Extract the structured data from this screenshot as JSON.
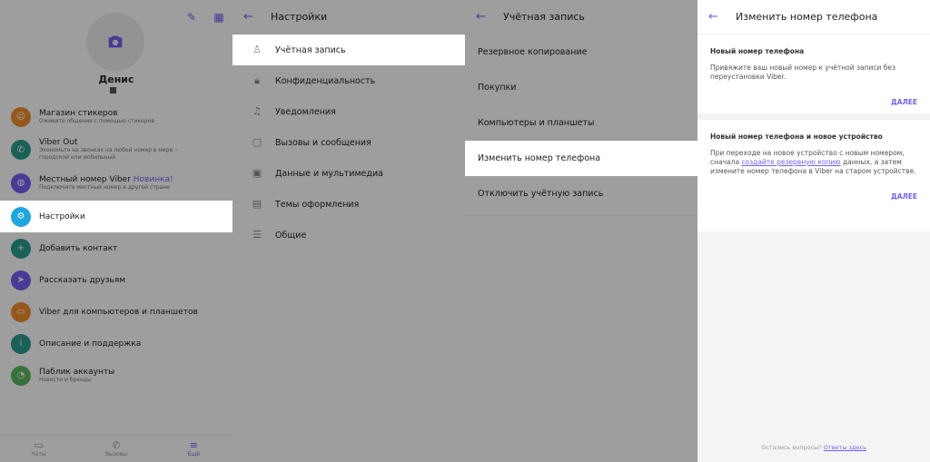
{
  "colors": {
    "accent": "#7360f2"
  },
  "panel1": {
    "user_name": "Денис",
    "menu": [
      {
        "title": "Магазин стикеров",
        "subtitle": "Оживите общение с помощью стикеров",
        "icon": "sticker-icon",
        "color": "#f28e2b"
      },
      {
        "title": "Viber Out",
        "subtitle": "Экономьте на звонках на любой номер в мире – городской или мобильный",
        "icon": "phone-icon",
        "color": "#2a9d8f"
      },
      {
        "title": "Местный номер Viber",
        "badge": "Новинка!",
        "subtitle": "Подключите местный номер в другой стране",
        "icon": "globe-icon",
        "color": "#7360f2"
      },
      {
        "title": "Настройки",
        "subtitle": "",
        "icon": "gear-icon",
        "color": "#1fa6e0"
      },
      {
        "title": "Добавить контакт",
        "subtitle": "",
        "icon": "add-contact-icon",
        "color": "#2a9d8f"
      },
      {
        "title": "Рассказать друзьям",
        "subtitle": "",
        "icon": "share-icon",
        "color": "#7360f2"
      },
      {
        "title": "Viber для компьютеров и планшетов",
        "subtitle": "",
        "icon": "desktop-icon",
        "color": "#f28e2b"
      },
      {
        "title": "Описание и поддержка",
        "subtitle": "",
        "icon": "info-icon",
        "color": "#2a9d8f"
      },
      {
        "title": "Паблик аккаунты",
        "subtitle": "Новости и бренды",
        "icon": "compass-icon",
        "color": "#5cb85c"
      }
    ],
    "bottom_nav": [
      {
        "label": "Чаты",
        "icon": "chat-icon"
      },
      {
        "label": "Вызовы",
        "icon": "phone-icon"
      },
      {
        "label": "Ещё",
        "icon": "menu-icon"
      }
    ]
  },
  "panel2": {
    "title": "Настройки",
    "items": [
      {
        "label": "Учётная запись",
        "icon": "user-icon"
      },
      {
        "label": "Конфиденциальность",
        "icon": "lock-icon"
      },
      {
        "label": "Уведомления",
        "icon": "bell-icon"
      },
      {
        "label": "Вызовы и сообщения",
        "icon": "message-icon"
      },
      {
        "label": "Данные и мультимедиа",
        "icon": "image-icon"
      },
      {
        "label": "Темы оформления",
        "icon": "brush-icon"
      },
      {
        "label": "Общие",
        "icon": "list-icon"
      }
    ]
  },
  "panel3": {
    "title": "Учётная запись",
    "items": [
      {
        "label": "Резервное копирование"
      },
      {
        "label": "Покупки"
      },
      {
        "label": "Компьютеры и планшеты"
      },
      {
        "label": "Изменить номер телефона"
      },
      {
        "label": "Отключить учётную запись"
      }
    ]
  },
  "panel4": {
    "title": "Изменить номер телефона",
    "card1": {
      "heading": "Новый номер телефона",
      "text": "Привяжите ваш новый номер к учётной записи без переустановки Viber.",
      "next": "ДАЛЕЕ"
    },
    "card2": {
      "heading": "Новый номер телефона и новое устройство",
      "text_before": "При переходе на новое устройство с новым номером, сначала ",
      "link": "создайте резервную копию",
      "text_after": " данных, а затем измените номер телефона в Viber на старом устройстве.",
      "next": "ДАЛЕЕ"
    },
    "footer_text": "Остались вопросы? ",
    "footer_link": "Ответы здесь"
  }
}
